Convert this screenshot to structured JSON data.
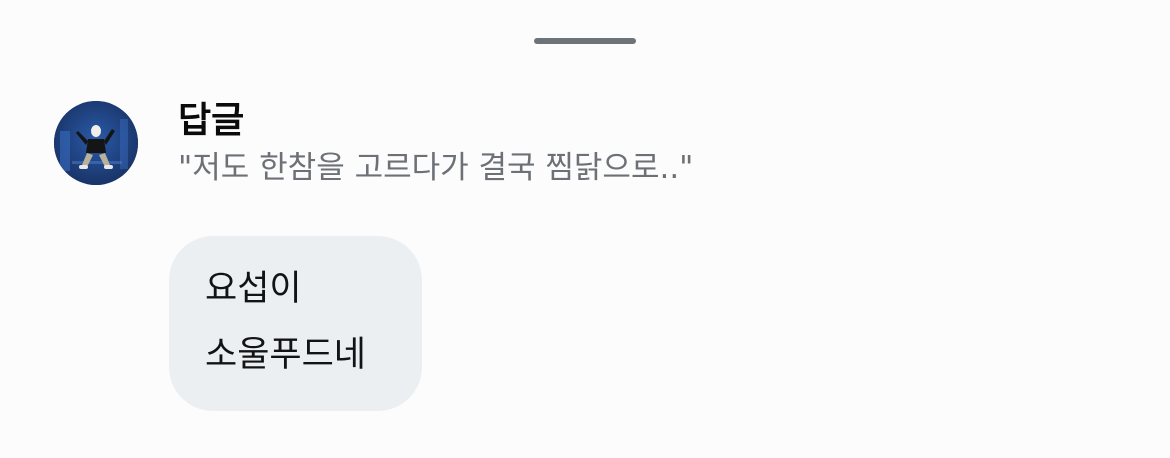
{
  "sheet": {
    "grabber_icon": "drag-handle"
  },
  "reply_context": {
    "title": "답글",
    "quote": "\"저도 한참을 고르다가 결국 찜닭으로..\"",
    "avatar_icon": "user-avatar"
  },
  "message": {
    "lines": [
      "요섭이",
      "소울푸드네"
    ]
  },
  "colors": {
    "background": "#fcfcfd",
    "bubble": "#eceff2",
    "grabber": "#6e7378",
    "quote_text": "#6d7176",
    "avatar_bg": "#1d3f7c"
  }
}
